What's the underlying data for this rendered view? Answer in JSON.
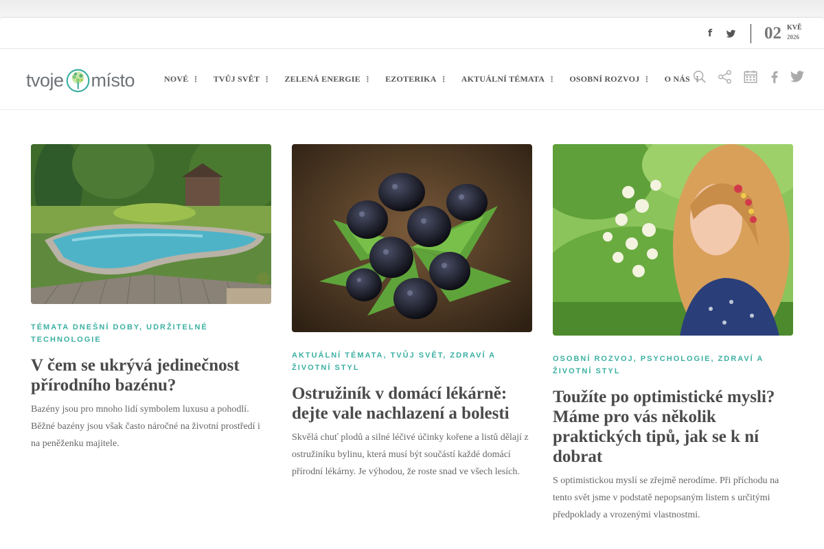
{
  "topbar": {
    "date_day": "02",
    "date_month": "KVĚ",
    "date_year": "2026",
    "social": [
      "facebook-icon",
      "twitter-icon"
    ]
  },
  "logo": {
    "word1": "tvoje",
    "word2": "místo"
  },
  "nav": {
    "items": [
      {
        "label": "NOVÉ"
      },
      {
        "label": "TVŮJ SVĚT"
      },
      {
        "label": "ZELENÁ ENERGIE"
      },
      {
        "label": "EZOTERIKA"
      },
      {
        "label": "AKTUÁLNÍ TÉMATA"
      },
      {
        "label": "OSOBNÍ ROZVOJ"
      },
      {
        "label": "O NÁS"
      }
    ],
    "icons": [
      "search-icon",
      "share-icon",
      "calendar-icon",
      "facebook-icon",
      "twitter-icon"
    ]
  },
  "colors": {
    "accent": "#3bb0a2",
    "title": "#4a4a4a",
    "text": "#666666"
  },
  "articles": [
    {
      "categories": "TÉMATA DNEŠNÍ DOBY, UDRŽITELNÉ TECHNOLOGIE",
      "title": "V čem se ukrývá jedinečnost přírodního bazénu?",
      "excerpt": "Bazény jsou pro mnoho lidí symbolem luxusu a pohodlí. Běžné bazény jsou však často náročné na životní prostředí i na peněženku majitele."
    },
    {
      "categories": "AKTUÁLNÍ TÉMATA, TVŮJ SVĚT, ZDRAVÍ A ŽIVOTNÍ STYL",
      "title": "Ostružiník v domácí lékárně: dejte vale nachlazení a bolesti",
      "excerpt": "Skvělá chuť plodů a silné léčivé účinky kořene a listů dělají z ostružiníku bylinu, která musí být součástí každé domácí přírodní lékárny. Je výhodou, že roste snad ve všech lesích."
    },
    {
      "categories": "OSOBNÍ ROZVOJ, PSYCHOLOGIE, ZDRAVÍ A ŽIVOTNÍ STYL",
      "title": "Toužíte po optimistické mysli? Máme pro vás několik praktických tipů, jak se k ní dobrat",
      "excerpt": "S optimistickou myslí se zřejmě nerodíme. Při příchodu na tento svět jsme v podstatě nepopsaným listem s určitými předpoklady a vrozenými vlastnostmi."
    }
  ]
}
